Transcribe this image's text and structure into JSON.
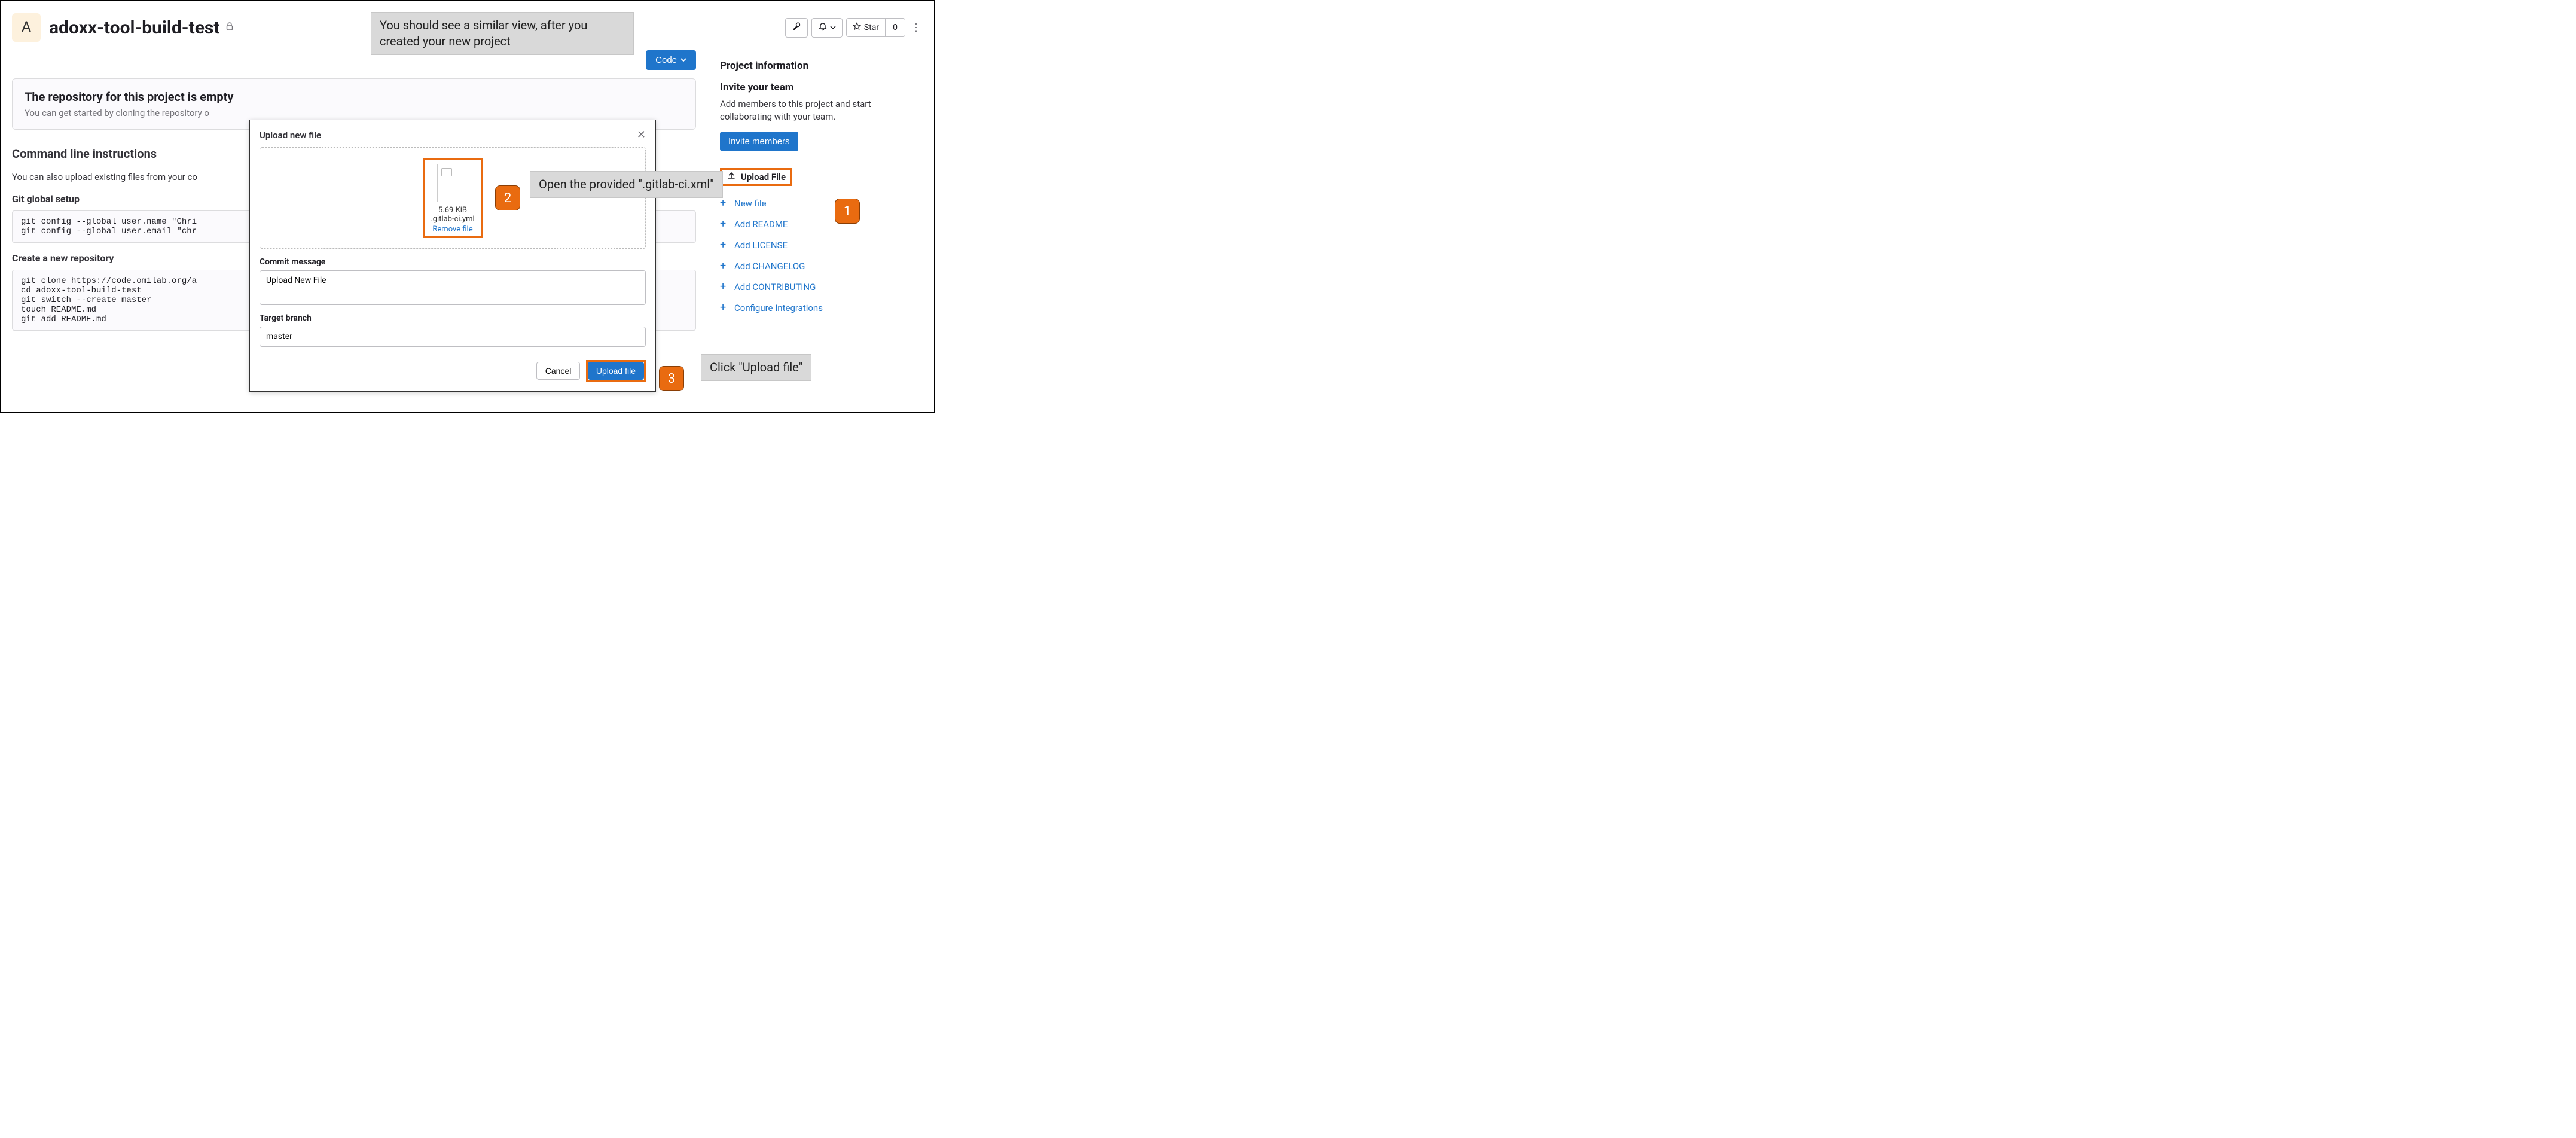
{
  "header": {
    "avatar_letter": "A",
    "project_name": "adoxx-tool-build-test",
    "star_label": "Star",
    "star_count": "0"
  },
  "code_button_label": "Code",
  "empty_repo": {
    "title": "The repository for this project is empty",
    "subtitle": "You can get started by cloning the repository o"
  },
  "cli": {
    "heading": "Command line instructions",
    "desc": "You can also upload existing files from your co",
    "setup_heading": "Git global setup",
    "setup_code": "git config --global user.name \"Chri\ngit config --global user.email \"chr",
    "create_heading": "Create a new repository",
    "create_code": "git clone https://code.omilab.org/a\ncd adoxx-tool-build-test\ngit switch --create master\ntouch README.md\ngit add README.md"
  },
  "sidebar": {
    "info_heading": "Project information",
    "invite_heading": "Invite your team",
    "invite_desc": "Add members to this project and start collaborating with your team.",
    "invite_button": "Invite members",
    "upload_file_label": "Upload File",
    "actions": [
      "New file",
      "Add README",
      "Add LICENSE",
      "Add CHANGELOG",
      "Add CONTRIBUTING",
      "Configure Integrations"
    ]
  },
  "modal": {
    "title": "Upload new file",
    "file_size": "5.69 KiB",
    "file_name": ".gitlab-ci.yml",
    "remove_label": "Remove file",
    "commit_label": "Commit message",
    "commit_value": "Upload New File",
    "branch_label": "Target branch",
    "branch_value": "master",
    "cancel_label": "Cancel",
    "upload_label": "Upload file"
  },
  "annotations": {
    "top": "You should see a similar view, after you created your new project",
    "open": "Open the provided \".gitlab-ci.xml\"",
    "click": "Click \"Upload file\"",
    "step1": "1",
    "step2": "2",
    "step3": "3"
  }
}
